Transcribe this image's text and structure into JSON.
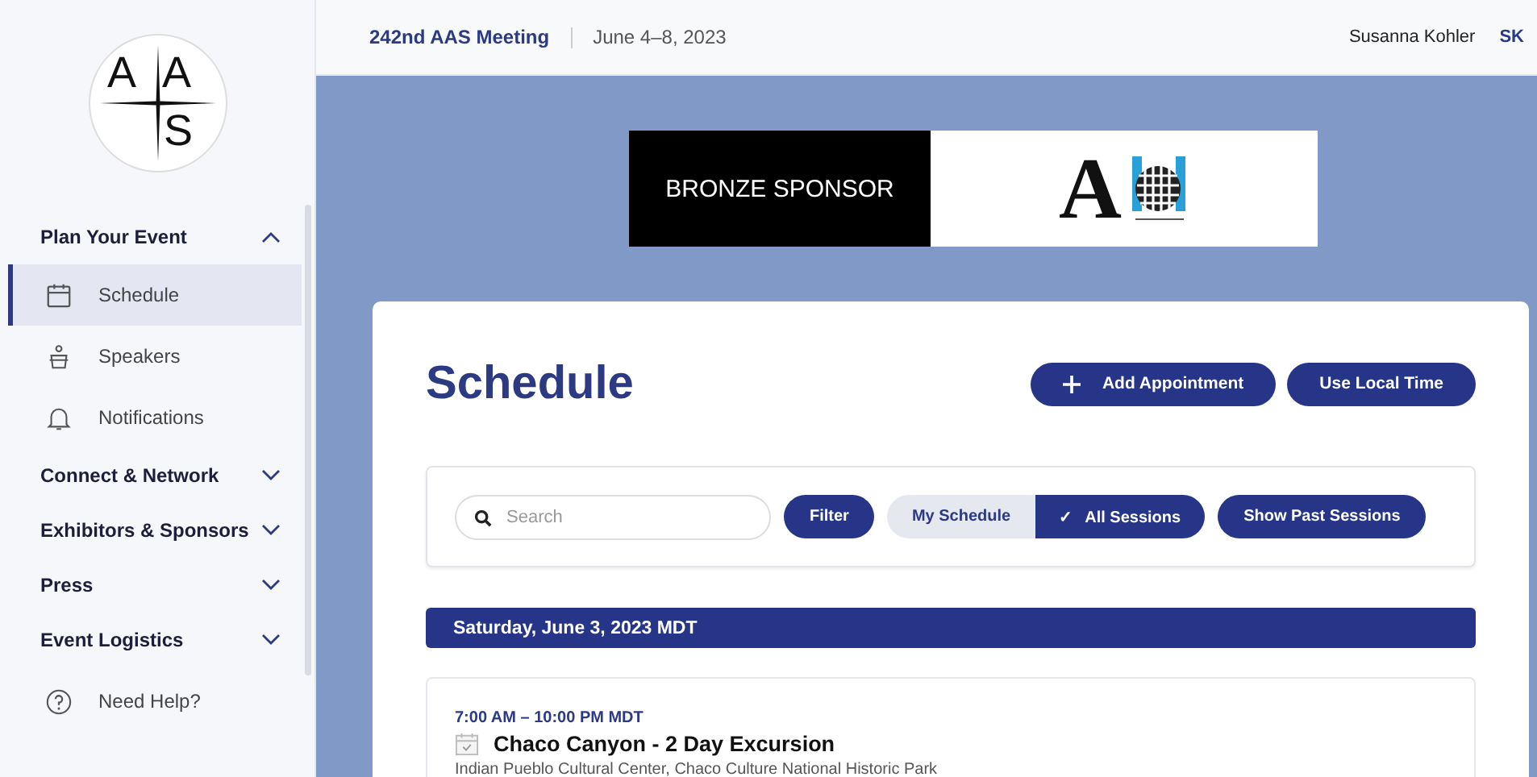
{
  "logo": {
    "letters": [
      "A",
      "A",
      "S"
    ]
  },
  "header": {
    "event": "242nd AAS Meeting",
    "dates": "June 4–8, 2023",
    "user_name": "Susanna Kohler",
    "user_initials": "SK"
  },
  "sidebar": {
    "sections": [
      {
        "label": "Plan Your Event",
        "expanded": true,
        "children": [
          {
            "label": "Schedule",
            "selected": true
          },
          {
            "label": "Speakers",
            "selected": false
          },
          {
            "label": "Notifications",
            "selected": false
          }
        ]
      },
      {
        "label": "Connect & Network",
        "expanded": false
      },
      {
        "label": "Exhibitors & Sponsors",
        "expanded": false
      },
      {
        "label": "Press",
        "expanded": false
      },
      {
        "label": "Event Logistics",
        "expanded": false
      }
    ],
    "help": "Need Help?"
  },
  "sponsor": {
    "label": "BRONZE SPONSOR",
    "logo_letter": "A"
  },
  "page": {
    "title": "Schedule",
    "buttons": [
      {
        "label": "Add Appointment",
        "kind": "add"
      },
      {
        "label": "Use Local Time",
        "kind": "plain"
      }
    ]
  },
  "toolbar": {
    "search": {
      "placeholder": "Search"
    },
    "filter": "Filter",
    "views": [
      {
        "label": "My Schedule",
        "selected": false
      },
      {
        "label": "All Sessions",
        "selected": true
      }
    ],
    "check": "✓",
    "past": "Show Past Sessions"
  },
  "days": [
    {
      "label": "Saturday, June 3, 2023 MDT",
      "sessions": [
        {
          "time": "7:00 AM – 10:00 PM MDT",
          "title": "Chaco Canyon - 2 Day Excursion",
          "location": "Indian Pueblo Cultural Center, Chaco Culture National Historic Park"
        }
      ]
    }
  ]
}
